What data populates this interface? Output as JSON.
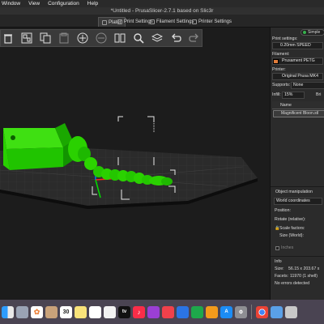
{
  "menubar": {
    "items": [
      "Window",
      "View",
      "Configuration",
      "Help"
    ]
  },
  "window": {
    "title": "*Untitled - PrusaSlicer-2.7.1 based on Slic3r"
  },
  "tabs": [
    {
      "label": "Plater"
    },
    {
      "label": "Print Settings"
    },
    {
      "label": "Filament Settings"
    },
    {
      "label": "Printer Settings"
    }
  ],
  "toolbar": {
    "buttons": [
      "delete-icon",
      "arrange-icon",
      "copy-icon",
      "paste-icon",
      "add-instance-icon",
      "remove-instance-icon",
      "split-icon",
      "search-icon",
      "layers-icon",
      "undo-icon",
      "redo-icon"
    ]
  },
  "panel": {
    "mode": "Simple",
    "print_settings_label": "Print settings:",
    "print_settings_value": "0.20mm SPEED",
    "filament_label": "Filament:",
    "filament_value": "Prusament PETG",
    "filament_color": "#e27d3b",
    "printer_label": "Printer:",
    "printer_value": "Original Prusa MK4",
    "supports_label": "Supports:",
    "supports_value": "None",
    "infill_label": "Infill:",
    "infill_value": "15%",
    "brim_label": "Bri",
    "name_header": "Name",
    "object_name": "Magnificent Bloon.stl",
    "object_manipulation": "Object manipulation",
    "coord_system": "World coordinates",
    "position_label": "Position:",
    "rotate_label": "Rotate (relative):",
    "scale_label": "Scale factors:",
    "size_label": "Size (World):",
    "inches_label": "Inches",
    "info_header": "Info",
    "size_info_label": "Size:",
    "size_info_value": "56.15 x 203.67 x",
    "facets_label": "Facets:",
    "facets_value": "11970 (1 shell)",
    "errors_text": "No errors detected"
  },
  "dock": {
    "date_number": "30",
    "apps": [
      "finder",
      "launchpad",
      "photos",
      "contacts",
      "calendar",
      "notes",
      "reminders",
      "freeform",
      "appletv",
      "music",
      "podcasts",
      "news",
      "keynote",
      "numbers",
      "pages",
      "appstore",
      "settings",
      "chrome",
      "preview",
      "trash"
    ]
  },
  "colors": {
    "model": "#22cc00",
    "model_dark": "#129400",
    "bed": "#2c2c2c",
    "accent": "#e27d3b"
  }
}
